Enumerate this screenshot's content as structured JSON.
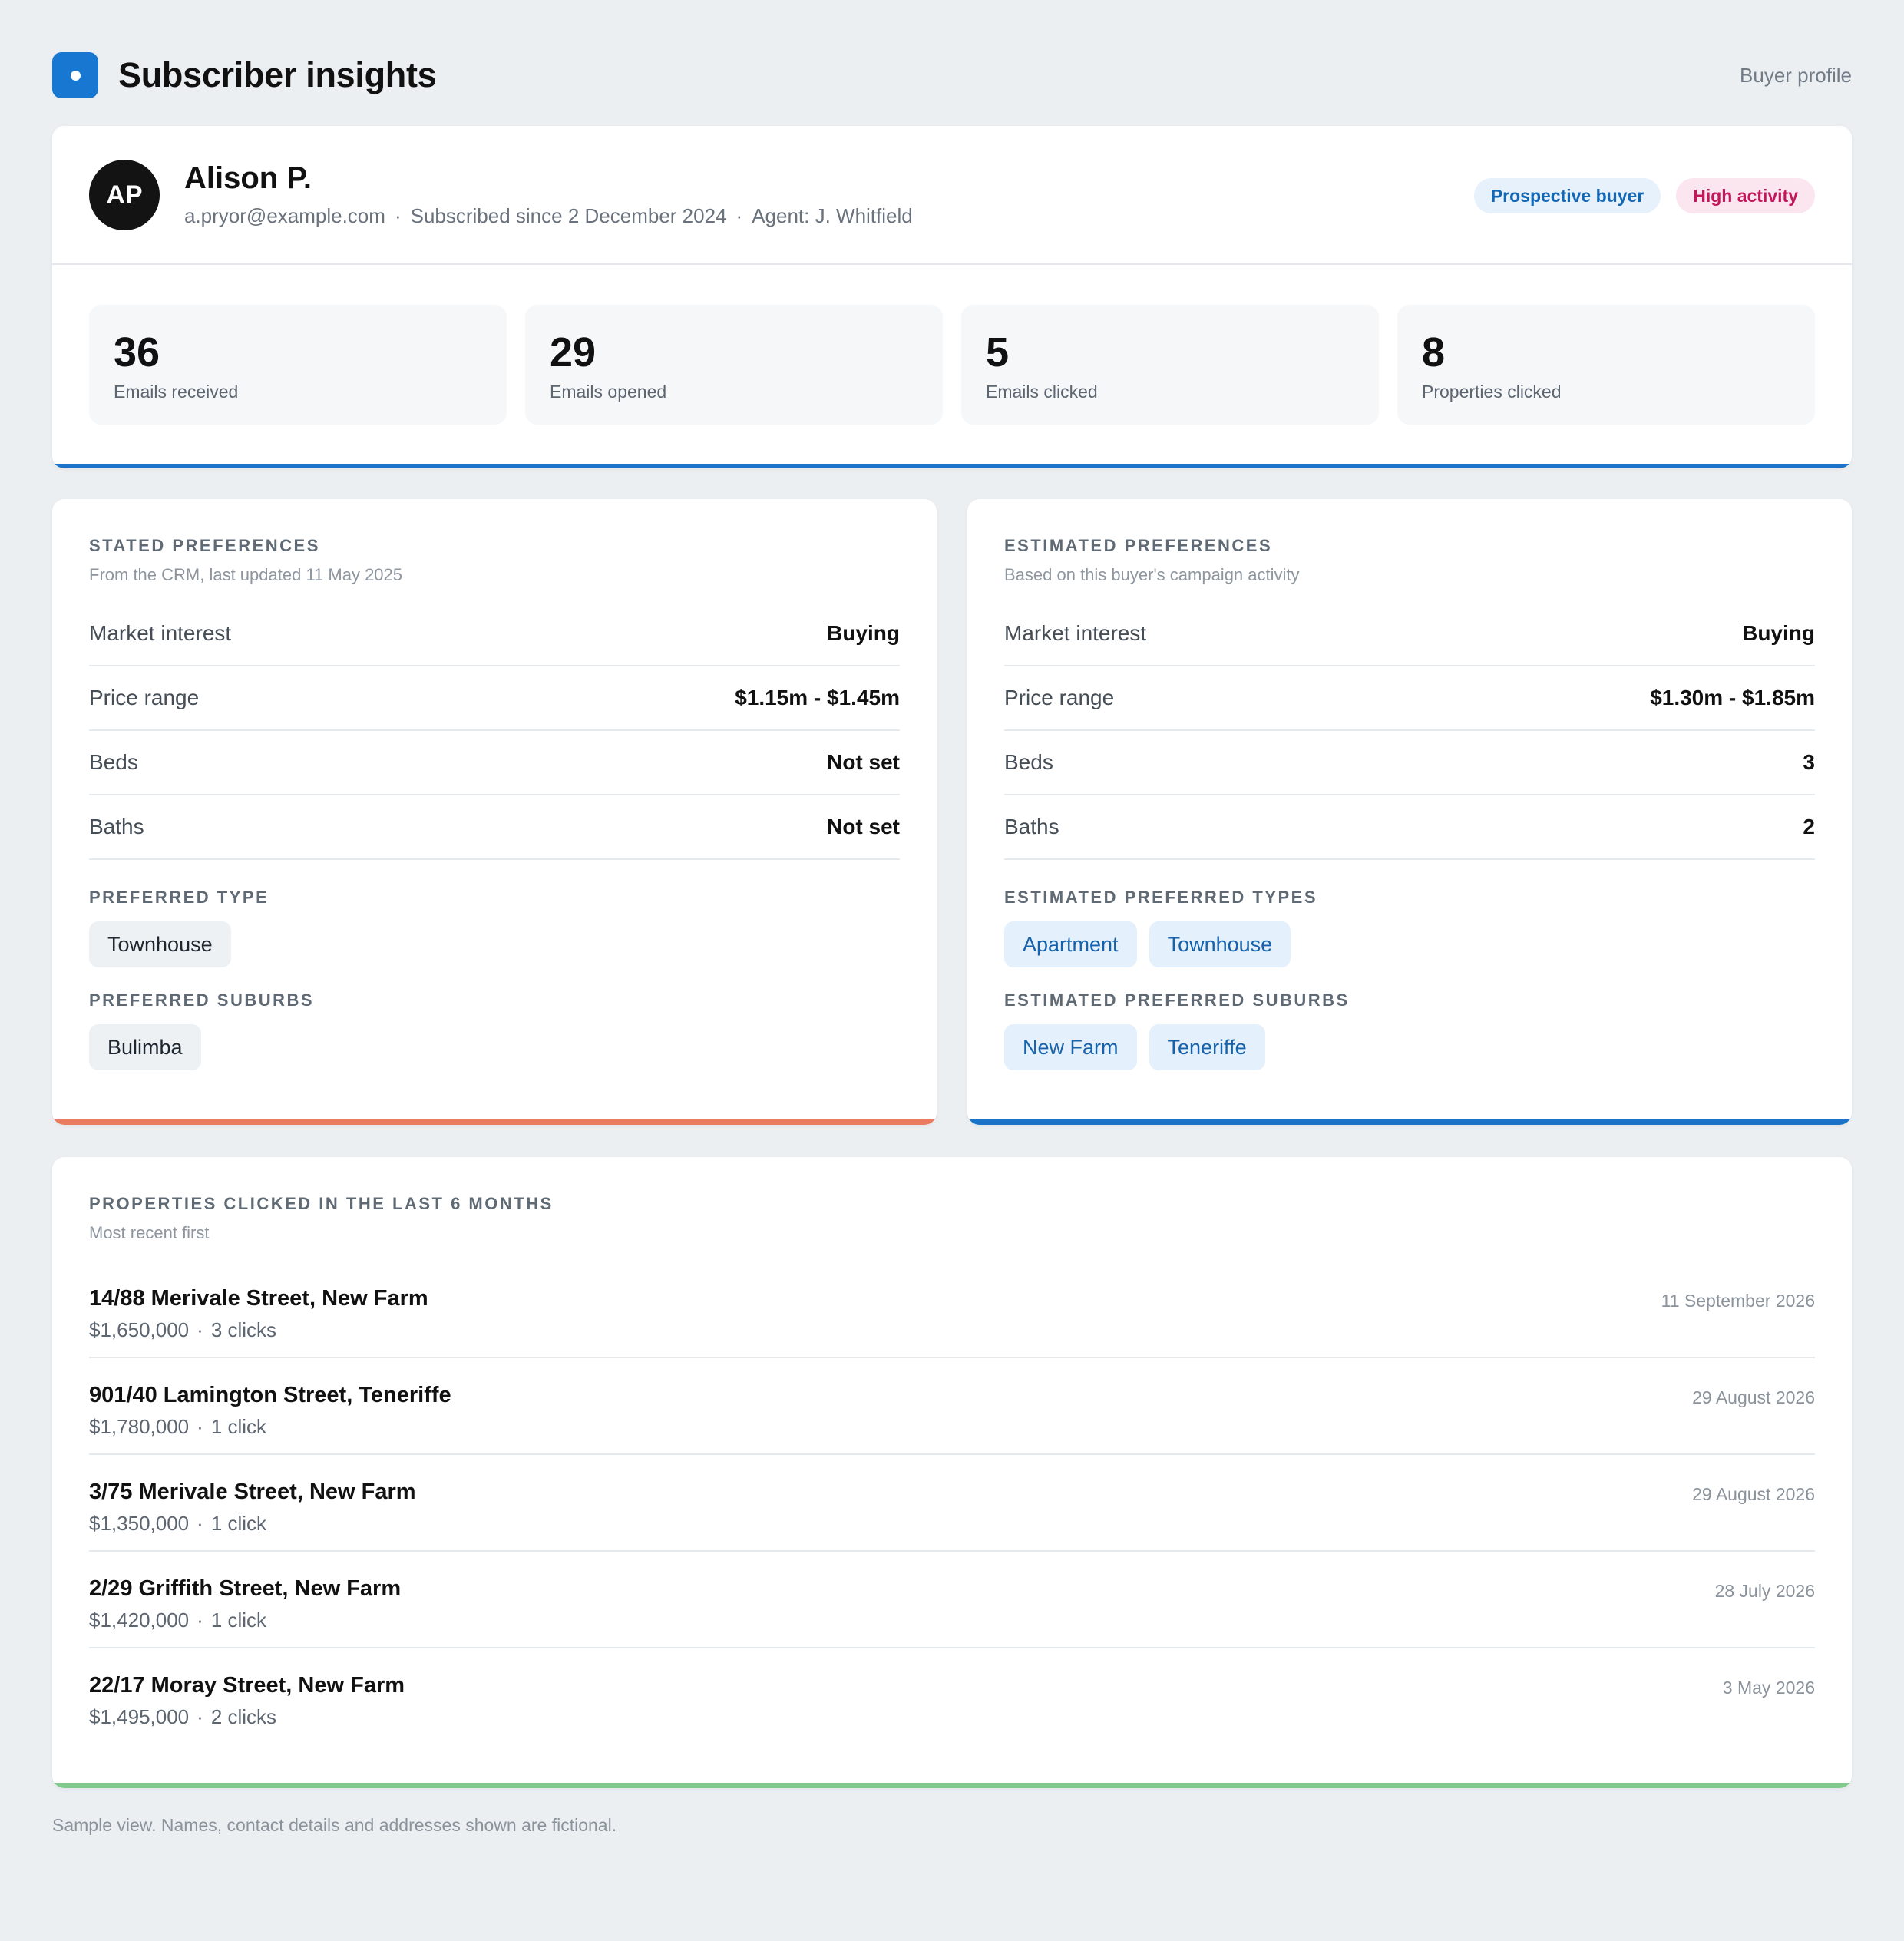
{
  "header": {
    "title": "Subscriber insights",
    "right_link": "Buyer profile"
  },
  "profile": {
    "initials": "AP",
    "name": "Alison P.",
    "email": "a.pryor@example.com",
    "subscribed": "Subscribed since 2 December 2024",
    "agent": "Agent: J. Whitfield",
    "separator": "·",
    "badges": [
      {
        "label": "Prospective buyer",
        "color": "#1467b5"
      },
      {
        "label": "High activity",
        "color": "#c2185b"
      }
    ],
    "stats": [
      {
        "value": "36",
        "label": "Emails received"
      },
      {
        "value": "29",
        "label": "Emails opened"
      },
      {
        "value": "5",
        "label": "Emails clicked"
      },
      {
        "value": "8",
        "label": "Properties clicked"
      }
    ]
  },
  "stated": {
    "title": "STATED PREFERENCES",
    "subtitle": "From the CRM, last updated 11 May 2025",
    "rows": [
      {
        "label": "Market interest",
        "value": "Buying"
      },
      {
        "label": "Price range",
        "value": "$1.15m - $1.45m"
      },
      {
        "label": "Beds",
        "value": "Not set"
      },
      {
        "label": "Baths",
        "value": "Not set"
      }
    ],
    "types_title": "PREFERRED TYPE",
    "types": [
      "Townhouse"
    ],
    "suburbs_title": "PREFERRED SUBURBS",
    "suburbs": [
      "Bulimba"
    ],
    "accent": "#ea7a60"
  },
  "estimated": {
    "title": "ESTIMATED PREFERENCES",
    "subtitle": "Based on this buyer's campaign activity",
    "rows": [
      {
        "label": "Market interest",
        "value": "Buying"
      },
      {
        "label": "Price range",
        "value": "$1.30m - $1.85m"
      },
      {
        "label": "Beds",
        "value": "3"
      },
      {
        "label": "Baths",
        "value": "2"
      }
    ],
    "types_title": "ESTIMATED PREFERRED TYPES",
    "types": [
      "Apartment",
      "Townhouse"
    ],
    "suburbs_title": "ESTIMATED PREFERRED SUBURBS",
    "suburbs": [
      "New Farm",
      "Teneriffe"
    ],
    "accent": "#1a73c9"
  },
  "properties": {
    "title": "PROPERTIES CLICKED IN THE LAST 6 MONTHS",
    "subtitle": "Most recent first",
    "items": [
      {
        "address": "14/88 Merivale Street, New Farm",
        "price": "$1,650,000",
        "clicks": "3 clicks",
        "date": "11 September 2026"
      },
      {
        "address": "901/40 Lamington Street, Teneriffe",
        "price": "$1,780,000",
        "clicks": "1 click",
        "date": "29 August 2026"
      },
      {
        "address": "3/75 Merivale Street, New Farm",
        "price": "$1,350,000",
        "clicks": "1 click",
        "date": "29 August 2026"
      },
      {
        "address": "2/29 Griffith Street, New Farm",
        "price": "$1,420,000",
        "clicks": "1 click",
        "date": "28 July 2026"
      },
      {
        "address": "22/17 Moray Street, New Farm",
        "price": "$1,495,000",
        "clicks": "2 clicks",
        "date": "3 May 2026"
      }
    ],
    "accent": "#7fca8c"
  },
  "footnote": "Sample view. Names, contact details and addresses shown are fictional."
}
